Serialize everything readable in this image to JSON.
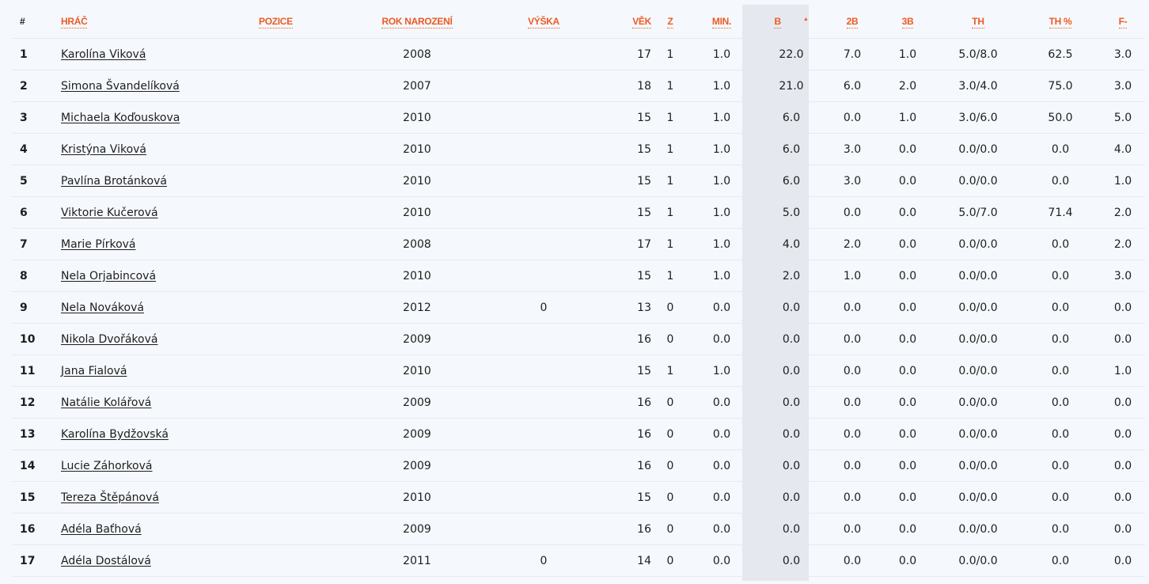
{
  "table": {
    "headers": {
      "rank": "#",
      "player": "HRÁČ",
      "position": "POZICE",
      "birth_year": "ROK NAROZENÍ",
      "height": "VÝŠKA",
      "age": "VĚK",
      "games": "Z",
      "minutes": "MIN.",
      "points": "B",
      "two_pt": "2B",
      "three_pt": "3B",
      "free_throws": "TH",
      "free_throw_pct": "TH %",
      "fouls": "F-"
    },
    "sorted_column": "points",
    "sort_direction": "descending",
    "accent_color": "#ee5a24",
    "rows": [
      {
        "rank": "1",
        "name": "Karolína Viková",
        "position": "",
        "birth_year": "2008",
        "height": "",
        "age": "17",
        "games": "1",
        "minutes": "1.0",
        "points": "22.0",
        "two_pt": "7.0",
        "three_pt": "1.0",
        "ft": "5.0/8.0",
        "ft_pct": "62.5",
        "fouls": "3.0"
      },
      {
        "rank": "2",
        "name": "Simona Švandelíková",
        "position": "",
        "birth_year": "2007",
        "height": "",
        "age": "18",
        "games": "1",
        "minutes": "1.0",
        "points": "21.0",
        "two_pt": "6.0",
        "three_pt": "2.0",
        "ft": "3.0/4.0",
        "ft_pct": "75.0",
        "fouls": "3.0"
      },
      {
        "rank": "3",
        "name": "Michaela Koďouskova",
        "position": "",
        "birth_year": "2010",
        "height": "",
        "age": "15",
        "games": "1",
        "minutes": "1.0",
        "points": "6.0",
        "two_pt": "0.0",
        "three_pt": "1.0",
        "ft": "3.0/6.0",
        "ft_pct": "50.0",
        "fouls": "5.0"
      },
      {
        "rank": "4",
        "name": "Kristýna Viková",
        "position": "",
        "birth_year": "2010",
        "height": "",
        "age": "15",
        "games": "1",
        "minutes": "1.0",
        "points": "6.0",
        "two_pt": "3.0",
        "three_pt": "0.0",
        "ft": "0.0/0.0",
        "ft_pct": "0.0",
        "fouls": "4.0"
      },
      {
        "rank": "5",
        "name": "Pavlína Brotánková",
        "position": "",
        "birth_year": "2010",
        "height": "",
        "age": "15",
        "games": "1",
        "minutes": "1.0",
        "points": "6.0",
        "two_pt": "3.0",
        "three_pt": "0.0",
        "ft": "0.0/0.0",
        "ft_pct": "0.0",
        "fouls": "1.0"
      },
      {
        "rank": "6",
        "name": "Viktorie Kučerová",
        "position": "",
        "birth_year": "2010",
        "height": "",
        "age": "15",
        "games": "1",
        "minutes": "1.0",
        "points": "5.0",
        "two_pt": "0.0",
        "three_pt": "0.0",
        "ft": "5.0/7.0",
        "ft_pct": "71.4",
        "fouls": "2.0"
      },
      {
        "rank": "7",
        "name": "Marie Pírková",
        "position": "",
        "birth_year": "2008",
        "height": "",
        "age": "17",
        "games": "1",
        "minutes": "1.0",
        "points": "4.0",
        "two_pt": "2.0",
        "three_pt": "0.0",
        "ft": "0.0/0.0",
        "ft_pct": "0.0",
        "fouls": "2.0"
      },
      {
        "rank": "8",
        "name": "Nela Orjabincová",
        "position": "",
        "birth_year": "2010",
        "height": "",
        "age": "15",
        "games": "1",
        "minutes": "1.0",
        "points": "2.0",
        "two_pt": "1.0",
        "three_pt": "0.0",
        "ft": "0.0/0.0",
        "ft_pct": "0.0",
        "fouls": "3.0"
      },
      {
        "rank": "9",
        "name": "Nela Nováková",
        "position": "",
        "birth_year": "2012",
        "height": "0",
        "age": "13",
        "games": "0",
        "minutes": "0.0",
        "points": "0.0",
        "two_pt": "0.0",
        "three_pt": "0.0",
        "ft": "0.0/0.0",
        "ft_pct": "0.0",
        "fouls": "0.0"
      },
      {
        "rank": "10",
        "name": "Nikola Dvořáková",
        "position": "",
        "birth_year": "2009",
        "height": "",
        "age": "16",
        "games": "0",
        "minutes": "0.0",
        "points": "0.0",
        "two_pt": "0.0",
        "three_pt": "0.0",
        "ft": "0.0/0.0",
        "ft_pct": "0.0",
        "fouls": "0.0"
      },
      {
        "rank": "11",
        "name": "Jana Fialová",
        "position": "",
        "birth_year": "2010",
        "height": "",
        "age": "15",
        "games": "1",
        "minutes": "1.0",
        "points": "0.0",
        "two_pt": "0.0",
        "three_pt": "0.0",
        "ft": "0.0/0.0",
        "ft_pct": "0.0",
        "fouls": "1.0"
      },
      {
        "rank": "12",
        "name": "Natálie Kolářová",
        "position": "",
        "birth_year": "2009",
        "height": "",
        "age": "16",
        "games": "0",
        "minutes": "0.0",
        "points": "0.0",
        "two_pt": "0.0",
        "three_pt": "0.0",
        "ft": "0.0/0.0",
        "ft_pct": "0.0",
        "fouls": "0.0"
      },
      {
        "rank": "13",
        "name": "Karolína Bydžovská",
        "position": "",
        "birth_year": "2009",
        "height": "",
        "age": "16",
        "games": "0",
        "minutes": "0.0",
        "points": "0.0",
        "two_pt": "0.0",
        "three_pt": "0.0",
        "ft": "0.0/0.0",
        "ft_pct": "0.0",
        "fouls": "0.0"
      },
      {
        "rank": "14",
        "name": "Lucie Záhorková",
        "position": "",
        "birth_year": "2009",
        "height": "",
        "age": "16",
        "games": "0",
        "minutes": "0.0",
        "points": "0.0",
        "two_pt": "0.0",
        "three_pt": "0.0",
        "ft": "0.0/0.0",
        "ft_pct": "0.0",
        "fouls": "0.0"
      },
      {
        "rank": "15",
        "name": "Tereza Štěpánová",
        "position": "",
        "birth_year": "2010",
        "height": "",
        "age": "15",
        "games": "0",
        "minutes": "0.0",
        "points": "0.0",
        "two_pt": "0.0",
        "three_pt": "0.0",
        "ft": "0.0/0.0",
        "ft_pct": "0.0",
        "fouls": "0.0"
      },
      {
        "rank": "16",
        "name": "Adéla Baťhová",
        "position": "",
        "birth_year": "2009",
        "height": "",
        "age": "16",
        "games": "0",
        "minutes": "0.0",
        "points": "0.0",
        "two_pt": "0.0",
        "three_pt": "0.0",
        "ft": "0.0/0.0",
        "ft_pct": "0.0",
        "fouls": "0.0"
      },
      {
        "rank": "17",
        "name": "Adéla Dostálová",
        "position": "",
        "birth_year": "2011",
        "height": "0",
        "age": "14",
        "games": "0",
        "minutes": "0.0",
        "points": "0.0",
        "two_pt": "0.0",
        "three_pt": "0.0",
        "ft": "0.0/0.0",
        "ft_pct": "0.0",
        "fouls": "0.0"
      }
    ]
  }
}
